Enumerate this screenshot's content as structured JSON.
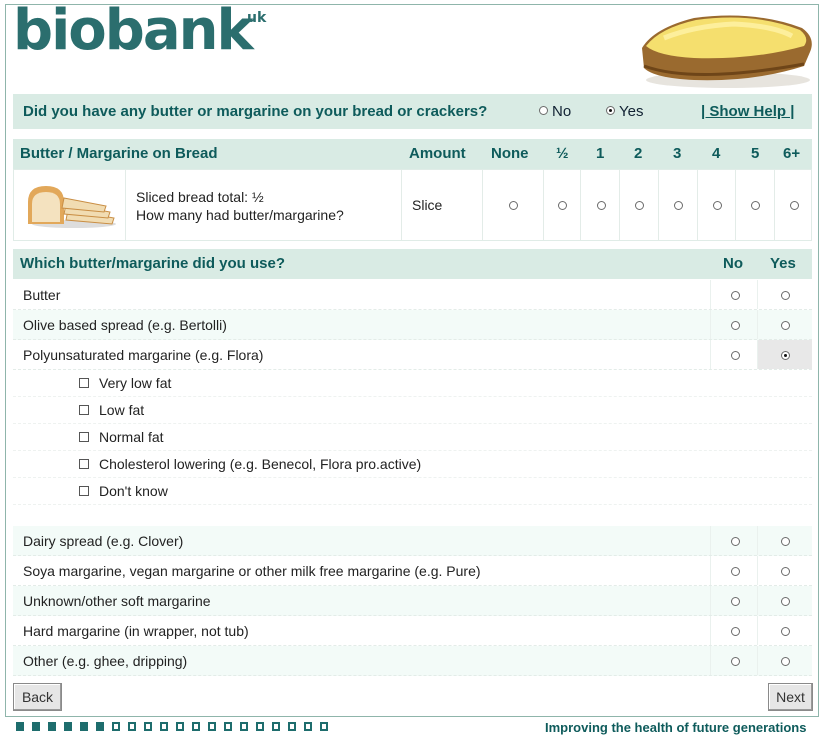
{
  "brand": {
    "name": "biobank",
    "suffix": "uk"
  },
  "question": {
    "text": "Did you have any butter or margarine on your bread or crackers?",
    "options": [
      {
        "label": "No",
        "selected": false
      },
      {
        "label": "Yes",
        "selected": true
      }
    ],
    "help_label": "| Show Help |"
  },
  "amount_table": {
    "headers": {
      "item": "Butter / Margarine on Bread",
      "amount": "Amount",
      "choices": [
        "None",
        "½",
        "1",
        "2",
        "3",
        "4",
        "5",
        "6+"
      ]
    },
    "row": {
      "line1": "Sliced bread total: ½",
      "line2": "How many had butter/margarine?",
      "unit": "Slice",
      "selected": null
    }
  },
  "which_table": {
    "question": "Which butter/margarine did you use?",
    "col_no": "No",
    "col_yes": "Yes",
    "rows": [
      {
        "label": "Butter",
        "value": null
      },
      {
        "label": "Olive based spread (e.g. Bertolli)",
        "value": null
      },
      {
        "label": "Polyunsaturated margarine (e.g. Flora)",
        "value": "Yes"
      }
    ],
    "sub_options": [
      {
        "label": "Very low fat",
        "checked": false
      },
      {
        "label": "Low fat",
        "checked": false
      },
      {
        "label": "Normal fat",
        "checked": false
      },
      {
        "label": "Cholesterol lowering (e.g. Benecol, Flora pro.active)",
        "checked": false
      },
      {
        "label": "Don't know",
        "checked": false
      }
    ],
    "rows_after": [
      {
        "label": "Dairy spread (e.g. Clover)",
        "value": null
      },
      {
        "label": "Soya margarine, vegan margarine or other milk free margarine (e.g. Pure)",
        "value": null
      },
      {
        "label": "Unknown/other soft margarine",
        "value": null
      },
      {
        "label": "Hard margarine (in wrapper, not tub)",
        "value": null
      },
      {
        "label": "Other (e.g. ghee, dripping)",
        "value": null
      }
    ]
  },
  "nav": {
    "back_label": "Back",
    "next_label": "Next"
  },
  "progress": {
    "completed": 6,
    "total": 20
  },
  "footer": {
    "tagline": "Improving the health of future generations"
  },
  "colors": {
    "accent": "#0e5b5b",
    "bar_bg": "#d9ebe4",
    "frame": "#8fb5ab"
  }
}
